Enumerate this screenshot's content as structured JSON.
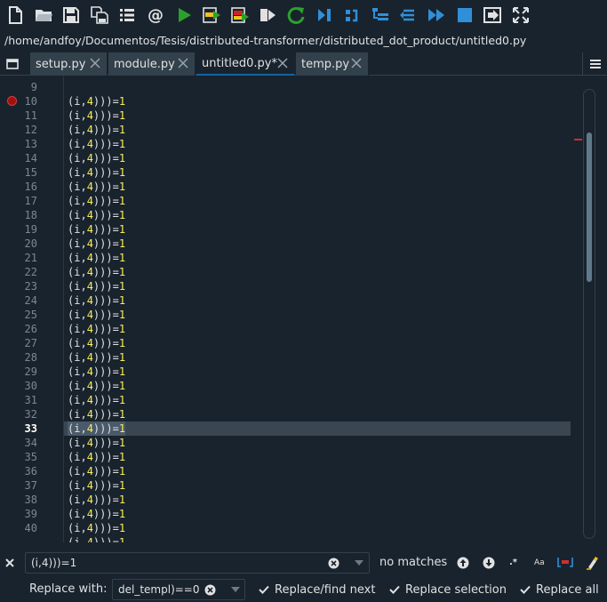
{
  "toolbar": {
    "buttons": [
      {
        "name": "new-file-icon"
      },
      {
        "name": "open-folder-icon"
      },
      {
        "name": "save-icon"
      },
      {
        "name": "save-all-icon"
      },
      {
        "name": "list-icon"
      },
      {
        "name": "at-sign-icon"
      },
      {
        "name": "run-icon"
      },
      {
        "name": "run-cell-icon"
      },
      {
        "name": "run-cell-advance-icon"
      },
      {
        "name": "run-selection-icon"
      },
      {
        "name": "rerun-icon"
      },
      {
        "name": "debug-icon"
      },
      {
        "name": "step-icon"
      },
      {
        "name": "step-into-icon"
      },
      {
        "name": "step-return-icon"
      },
      {
        "name": "continue-icon"
      },
      {
        "name": "stop-icon"
      },
      {
        "name": "exit-icon"
      },
      {
        "name": "maximize-icon"
      }
    ],
    "at_symbol": "@"
  },
  "path": "/home/andfoy/Documentos/Tesis/distributed-transformer/distributed_dot_product/untitled0.py",
  "tabs": [
    {
      "label": "setup.py"
    },
    {
      "label": "module.py"
    },
    {
      "label": "untitled0.py*"
    },
    {
      "label": "temp.py"
    }
  ],
  "editor": {
    "line_numbers": [
      "9",
      "10",
      "11",
      "12",
      "13",
      "14",
      "15",
      "16",
      "17",
      "18",
      "19",
      "20",
      "21",
      "22",
      "23",
      "24",
      "25",
      "26",
      "27",
      "28",
      "29",
      "30",
      "31",
      "32",
      "33",
      "34",
      "35",
      "36",
      "37",
      "38",
      "39",
      "40"
    ],
    "code_prefix": "(i,",
    "code_number": "4",
    "code_suffix": ")))=",
    "code_value": "1",
    "current_line": "33",
    "breakpoint_line": "10"
  },
  "find": {
    "query": "(i,4)))=1",
    "status": "no matches",
    "regex_label": ".*",
    "case_label": "Aa"
  },
  "replace": {
    "label": "Replace with:",
    "value": "del_templ)==0",
    "find_next": "Replace/find next",
    "selection": "Replace selection",
    "all": "Replace all"
  },
  "colors": {
    "background": "#19232d",
    "accent": "#1464a0",
    "number": "#faed5c",
    "run_green": "#2ca02c",
    "tool_blue": "#2f8fd8"
  }
}
